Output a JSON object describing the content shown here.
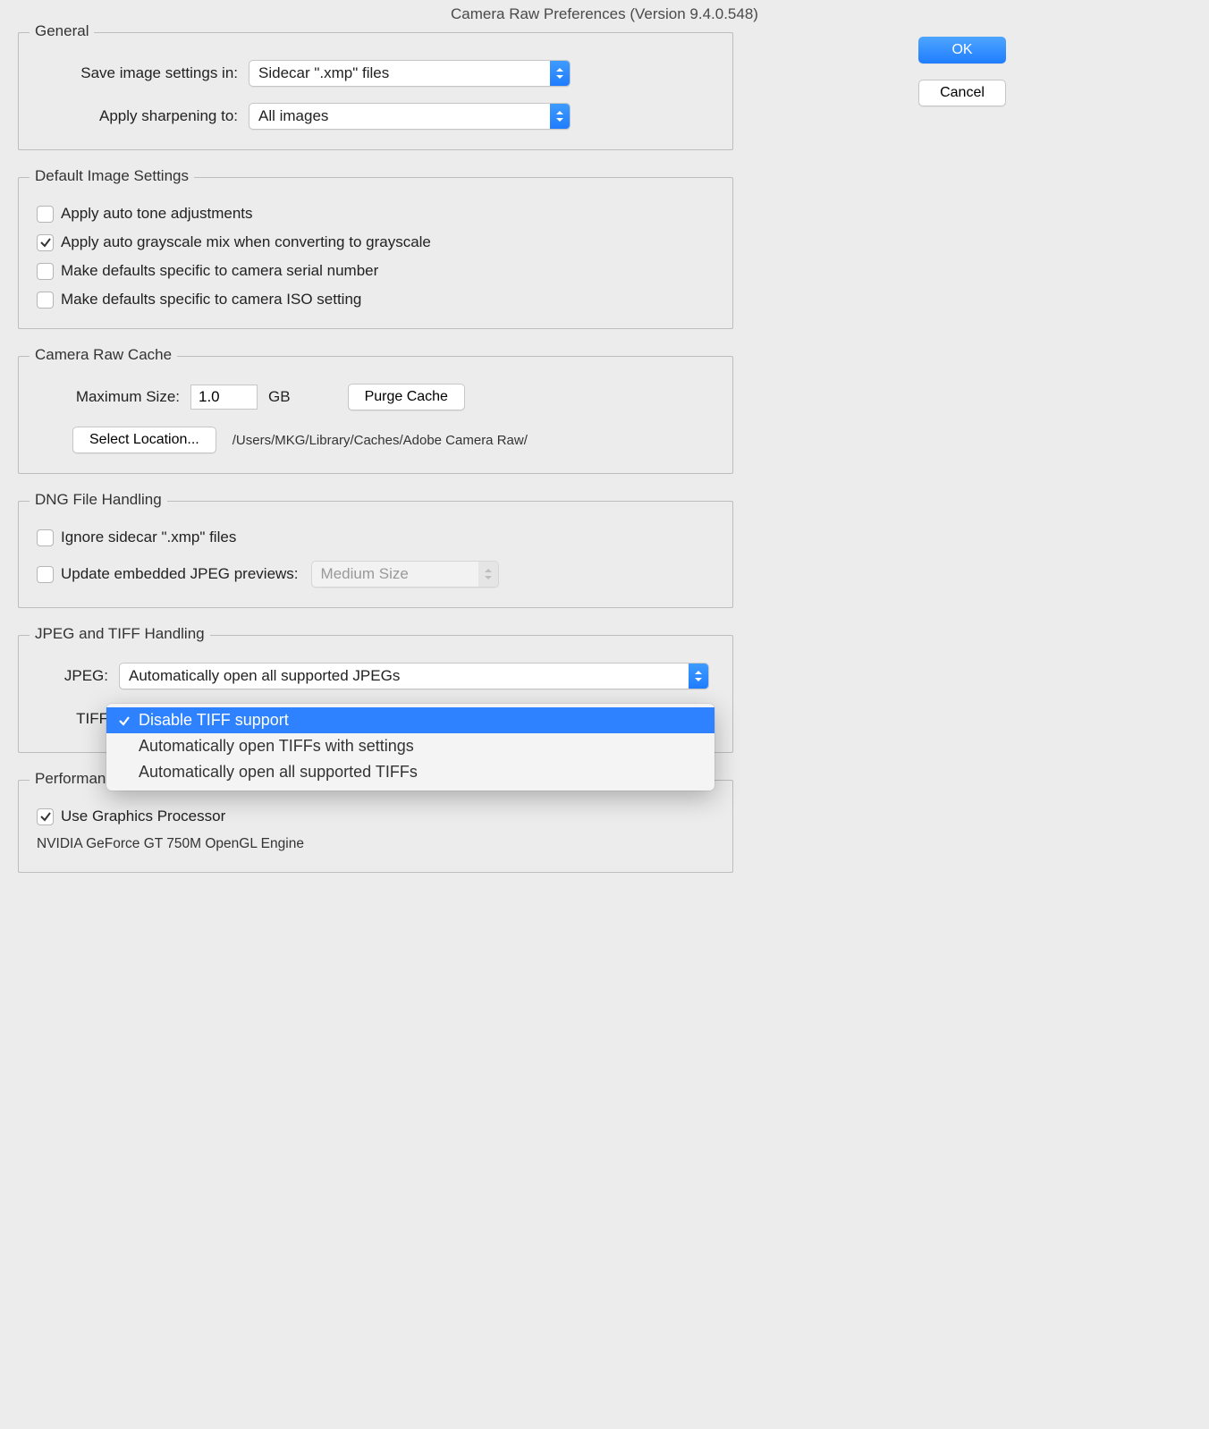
{
  "title": "Camera Raw Preferences  (Version 9.4.0.548)",
  "side": {
    "ok": "OK",
    "cancel": "Cancel"
  },
  "general": {
    "legend": "General",
    "save_label": "Save image settings in:",
    "save_value": "Sidecar \".xmp\" files",
    "sharpen_label": "Apply sharpening to:",
    "sharpen_value": "All images"
  },
  "defaults": {
    "legend": "Default Image Settings",
    "items": [
      {
        "label": "Apply auto tone adjustments",
        "checked": false
      },
      {
        "label": "Apply auto grayscale mix when converting to grayscale",
        "checked": true
      },
      {
        "label": "Make defaults specific to camera serial number",
        "checked": false
      },
      {
        "label": "Make defaults specific to camera ISO setting",
        "checked": false
      }
    ]
  },
  "cache": {
    "legend": "Camera Raw Cache",
    "max_label": "Maximum Size:",
    "max_value": "1.0",
    "unit": "GB",
    "purge": "Purge Cache",
    "select_location": "Select Location...",
    "path": "/Users/MKG/Library/Caches/Adobe Camera Raw/"
  },
  "dng": {
    "legend": "DNG File Handling",
    "ignore": {
      "label": "Ignore sidecar \".xmp\" files",
      "checked": false
    },
    "update": {
      "label": "Update embedded JPEG previews:",
      "checked": false
    },
    "preview_value": "Medium Size"
  },
  "jpegtiff": {
    "legend": "JPEG and TIFF Handling",
    "jpeg_label": "JPEG:",
    "jpeg_value": "Automatically open all supported JPEGs",
    "tiff_label": "TIFF",
    "tiff_options": [
      {
        "label": "Disable TIFF support",
        "selected": true
      },
      {
        "label": "Automatically open TIFFs with settings",
        "selected": false
      },
      {
        "label": "Automatically open all supported TIFFs",
        "selected": false
      }
    ]
  },
  "perf": {
    "legend": "Performance",
    "gpu": {
      "label": "Use Graphics Processor",
      "checked": true
    },
    "gpu_name": "NVIDIA GeForce GT 750M OpenGL Engine"
  }
}
